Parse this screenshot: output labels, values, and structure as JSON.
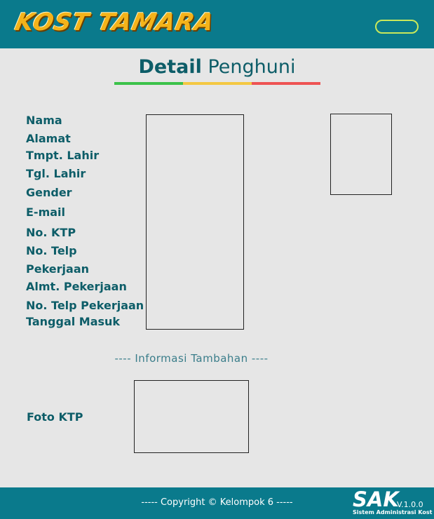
{
  "header": {
    "logo_text": "KOST TAMARA",
    "accent_color": "#0a7a8c"
  },
  "page": {
    "title_bold": "Detail",
    "title_rest": " Penghuni",
    "underline_colors": [
      "#3cc24a",
      "#f4c842",
      "#ee5353"
    ]
  },
  "fields": [
    {
      "label": "Nama"
    },
    {
      "label": "Alamat"
    },
    {
      "label": "Tmpt. Lahir"
    },
    {
      "label": "Tgl. Lahir"
    },
    {
      "label": "Gender"
    },
    {
      "label": "E-mail"
    },
    {
      "label": "No. KTP"
    },
    {
      "label": "No. Telp"
    },
    {
      "label": "Pekerjaan"
    },
    {
      "label": "Almt. Pekerjaan"
    },
    {
      "label": "No. Telp Pekerjaan"
    },
    {
      "label": "Tanggal Masuk"
    }
  ],
  "additional": {
    "heading": "---- Informasi Tambahan ----",
    "foto_ktp_label": "Foto KTP"
  },
  "footer": {
    "copyright": "----- Copyright © Kelompok 6 -----",
    "brand": "SAK",
    "version": "V.1.0.0",
    "brand_sub": "Sistem Administrasi Kost"
  }
}
